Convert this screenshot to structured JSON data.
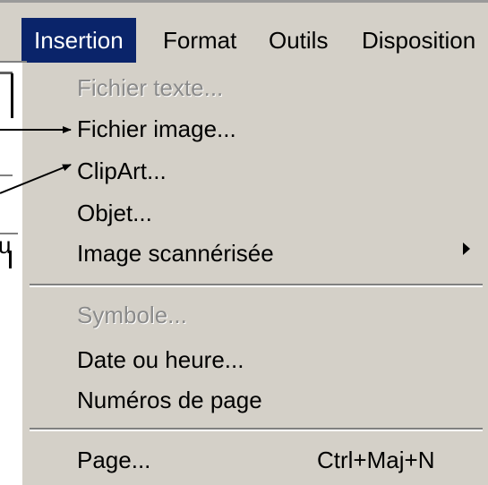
{
  "menubar": {
    "items": [
      {
        "label": "Insertion"
      },
      {
        "label": "Format"
      },
      {
        "label": "Outils"
      },
      {
        "label": "Disposition"
      }
    ]
  },
  "left_panel": {
    "fragment": "u"
  },
  "menu": {
    "items": [
      {
        "label": "Fichier texte...",
        "enabled": false
      },
      {
        "label": "Fichier image...",
        "enabled": true
      },
      {
        "label": "ClipArt...",
        "enabled": true
      },
      {
        "label": "Objet...",
        "enabled": true
      },
      {
        "label": "Image scannérisée",
        "enabled": true,
        "has_submenu": true
      },
      {
        "label": "Symbole...",
        "enabled": false
      },
      {
        "label": "Date ou heure...",
        "enabled": true
      },
      {
        "label": "Numéros de page",
        "enabled": true
      },
      {
        "label": "Page...",
        "enabled": true,
        "shortcut": "Ctrl+Maj+N"
      }
    ]
  },
  "colors": {
    "menu_background": "#d4d0c8",
    "active_menu_background": "#0a246a",
    "active_menu_text": "#ffffff",
    "disabled_text": "#8a8a8a"
  }
}
